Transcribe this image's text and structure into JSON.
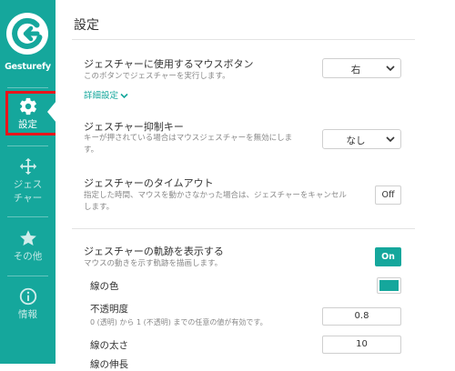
{
  "app": {
    "name": "Gesturefy",
    "accent_color": "#15a79c"
  },
  "sidebar": {
    "items": [
      {
        "label": "設定",
        "icon": "gear-icon",
        "active": true
      },
      {
        "label": "ジェス\nチャー",
        "icon": "move-arrows-icon",
        "active": false
      },
      {
        "label": "その他",
        "icon": "star-icon",
        "active": false
      },
      {
        "label": "情報",
        "icon": "info-icon",
        "active": false
      }
    ]
  },
  "page": {
    "title": "設定"
  },
  "settings": {
    "mouse_button": {
      "title": "ジェスチャーに使用するマウスボタン",
      "description": "このボタンでジェスチャーを実行します。",
      "value": "右"
    },
    "details_link": "詳細設定",
    "suppression_key": {
      "title": "ジェスチャー抑制キー",
      "description": "キーが押されている場合はマウスジェスチャーを無効にしま\nす。",
      "value": "なし"
    },
    "timeout": {
      "title": "ジェスチャーのタイムアウト",
      "description": "指定した時間、マウスを動かさなかった場合は、ジェスチャーをキャンセル\nします。",
      "toggle": "Off"
    },
    "trail": {
      "title": "ジェスチャーの軌跡を表示する",
      "description": "マウスの動きを示す軌跡を描画します。",
      "toggle": "On",
      "color_label": "線の色",
      "color_value": "#15a79c",
      "opacity_label": "不透明度",
      "opacity_desc": "0 (透明) から 1 (不透明) までの任意の値が有効です。",
      "opacity_value": "0.8",
      "width_label": "線の太さ",
      "width_value": "10",
      "growth_label": "線の伸長"
    }
  }
}
